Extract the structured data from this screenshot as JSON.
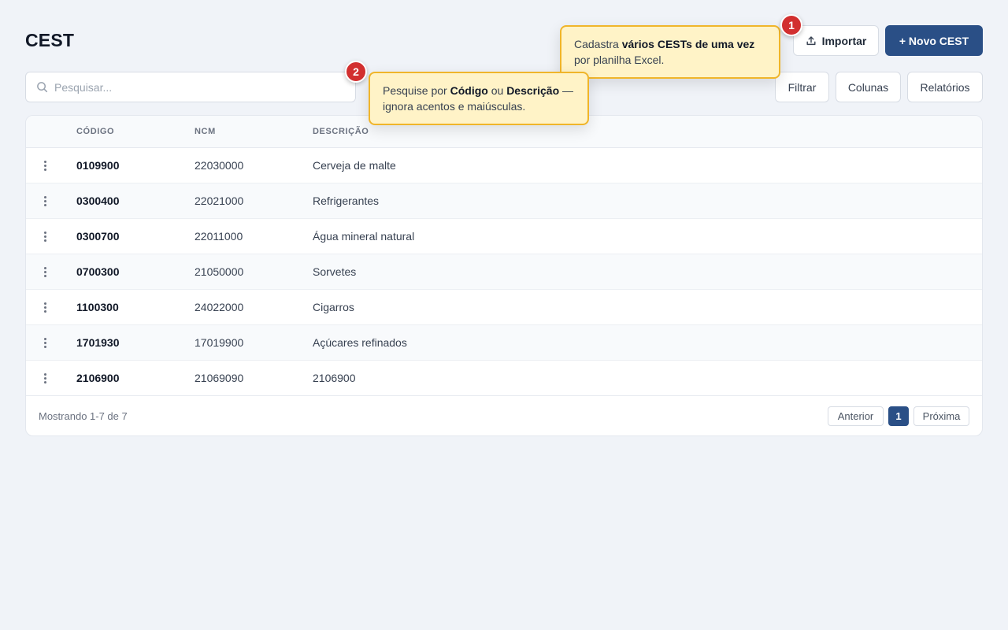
{
  "page": {
    "title": "CEST"
  },
  "toolbar": {
    "import_label": "Importar",
    "new_label": "+ Novo CEST",
    "search_placeholder": "Pesquisar...",
    "filter_label": "Filtrar",
    "columns_label": "Colunas",
    "reports_label": "Relatórios"
  },
  "table": {
    "columns": [
      "CÓDIGO",
      "NCM",
      "DESCRIÇÃO"
    ],
    "rows": [
      {
        "code": "0109900",
        "ncm": "22030000",
        "desc": "Cerveja de malte"
      },
      {
        "code": "0300400",
        "ncm": "22021000",
        "desc": "Refrigerantes"
      },
      {
        "code": "0300700",
        "ncm": "22011000",
        "desc": "Água mineral natural"
      },
      {
        "code": "0700300",
        "ncm": "21050000",
        "desc": "Sorvetes"
      },
      {
        "code": "1100300",
        "ncm": "24022000",
        "desc": "Cigarros"
      },
      {
        "code": "1701930",
        "ncm": "17019900",
        "desc": "Açúcares refinados"
      },
      {
        "code": "2106900",
        "ncm": "21069090",
        "desc": "2106900"
      }
    ]
  },
  "pagination": {
    "summary": "Mostrando 1-7 de 7",
    "prev_label": "Anterior",
    "current_page": "1",
    "next_label": "Próxima"
  },
  "tooltips": {
    "import": {
      "badge": "1",
      "text_before": "Cadastra ",
      "bold": "vários CESTs de uma vez",
      "text_after": " por planilha Excel."
    },
    "search": {
      "badge": "2",
      "text_before": "Pesquise por ",
      "bold1": "Código",
      "text_mid": " ou ",
      "bold2": "Descrição",
      "text_after": " — ignora acentos e maiúsculas."
    }
  },
  "icons": {
    "import": "upload-icon",
    "search": "search-icon",
    "row_menu": "kebab-menu-icon"
  },
  "colors": {
    "primary": "#2a4f86",
    "tooltip_bg": "#fff3c7",
    "tooltip_border": "#f0b52a",
    "badge": "#d22f2f"
  }
}
